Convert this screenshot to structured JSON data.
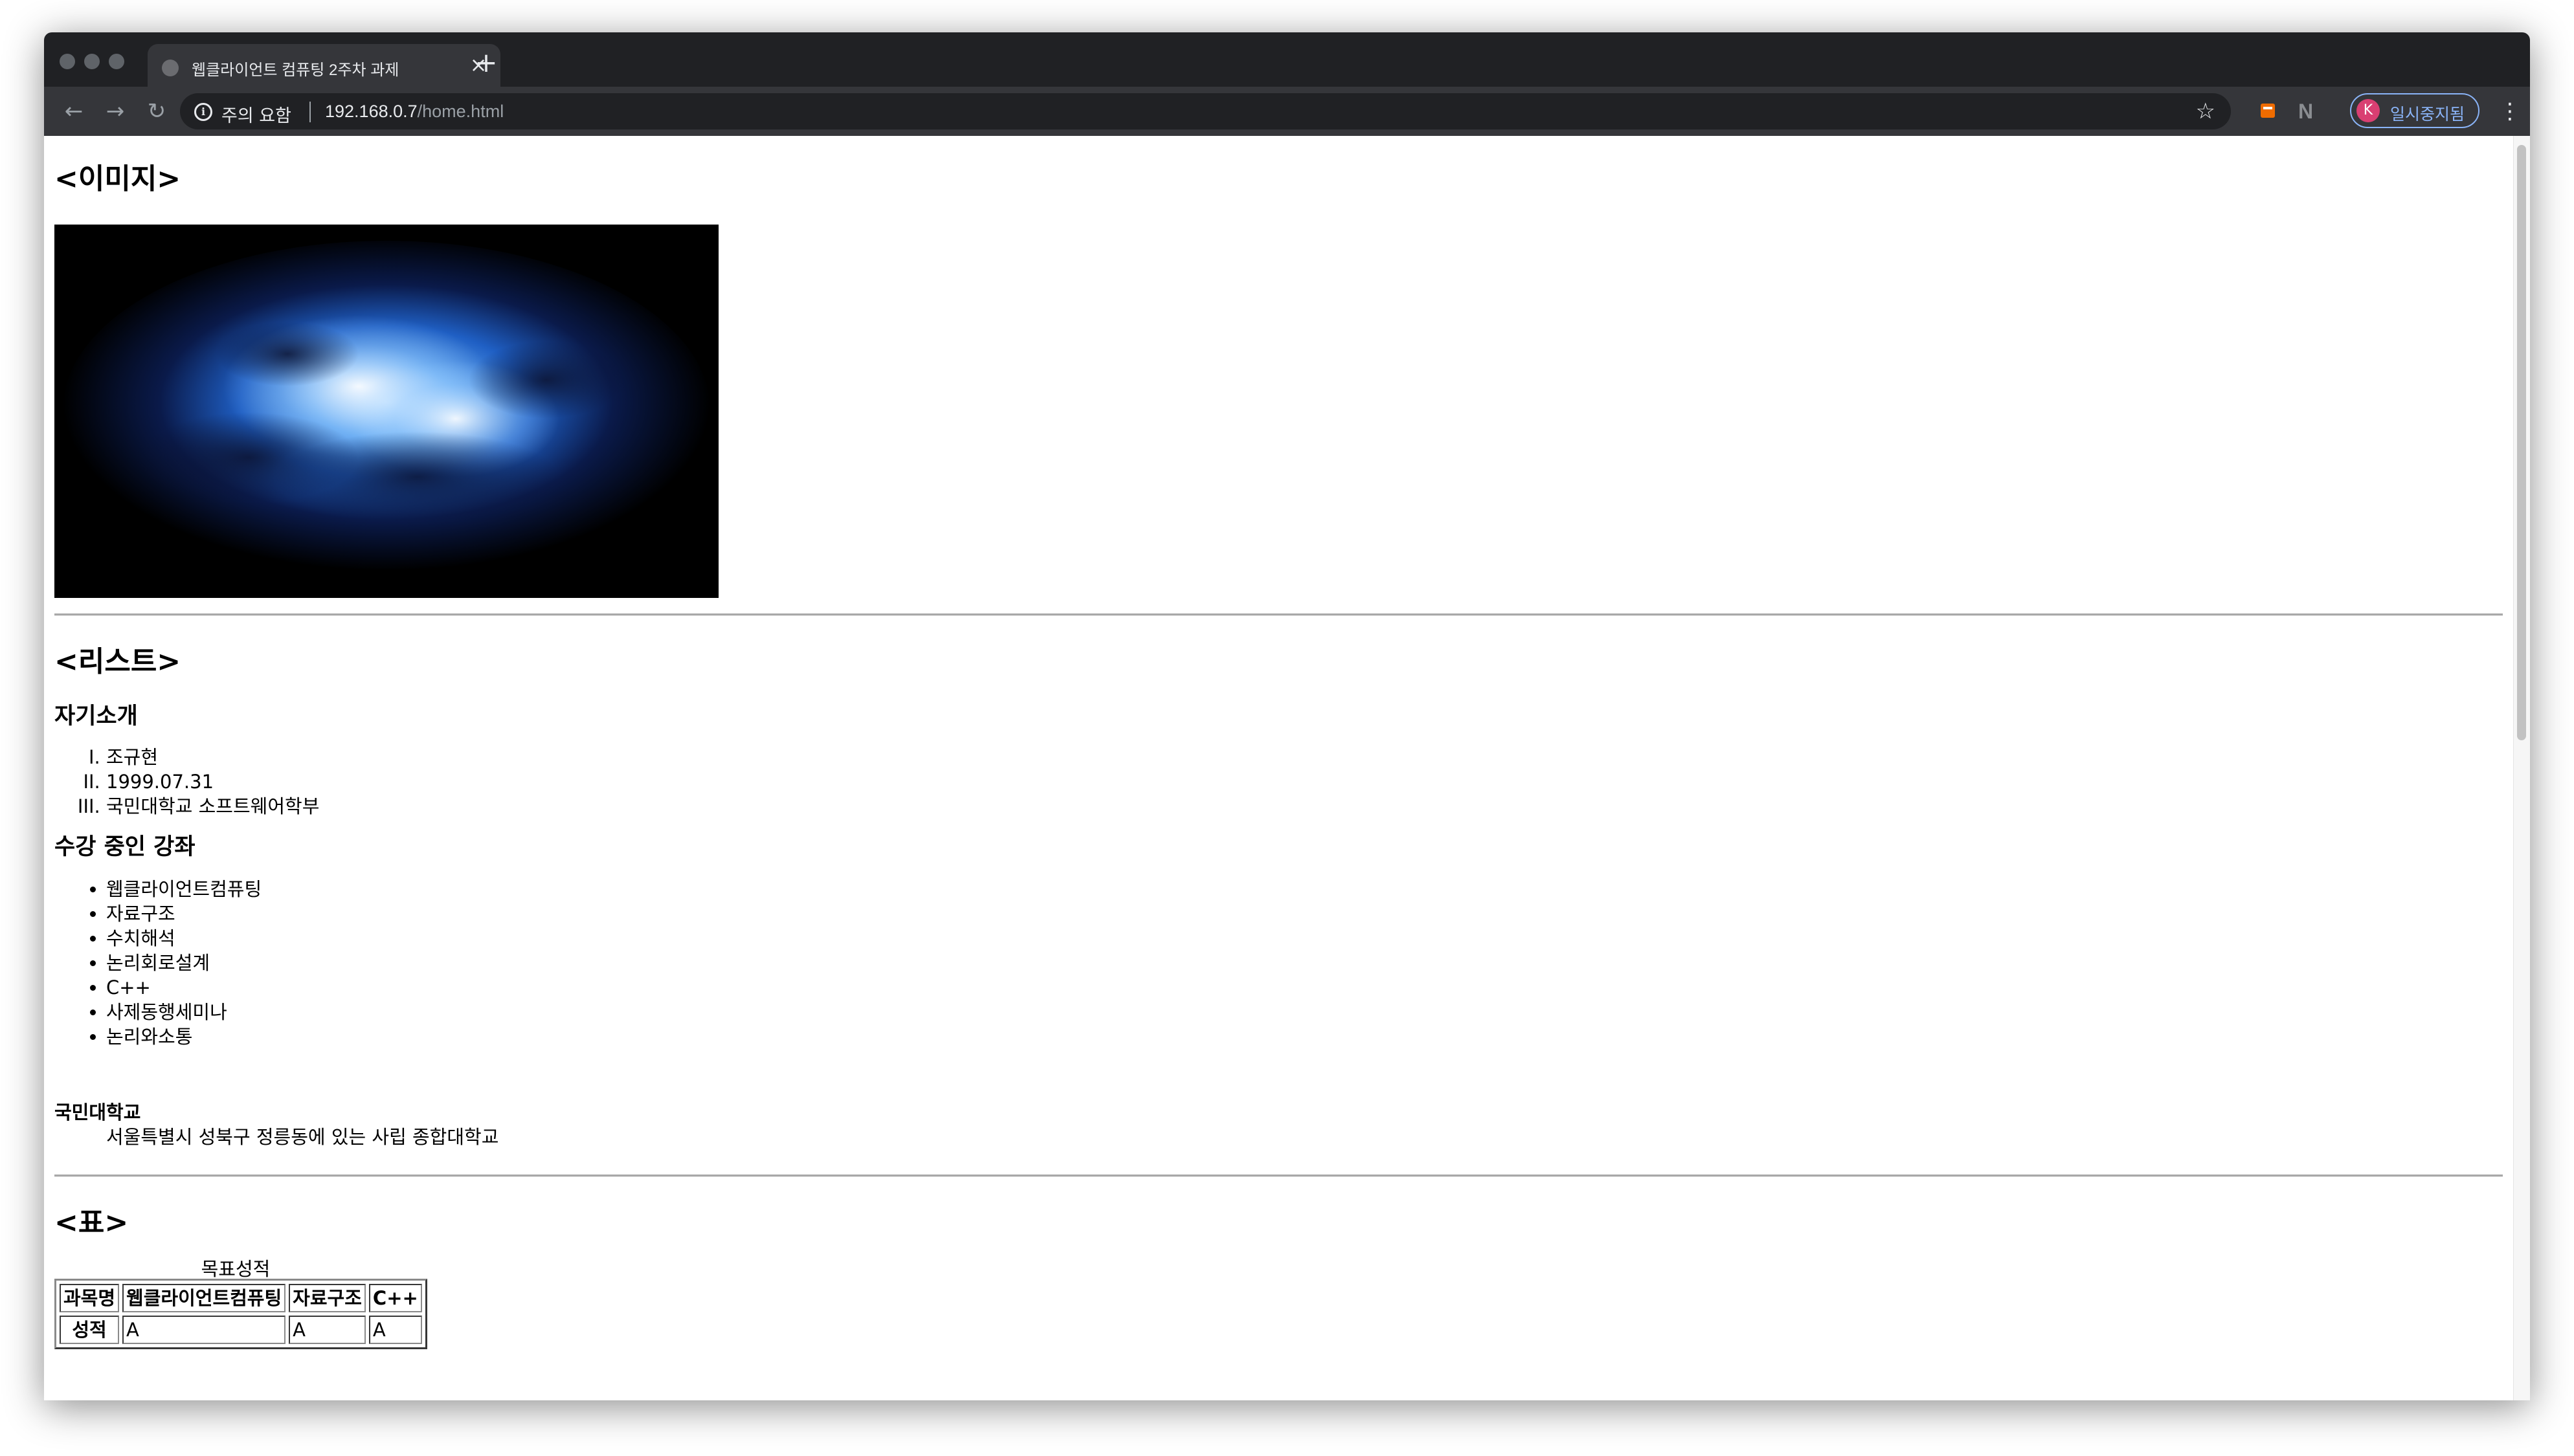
{
  "browser": {
    "tab_title": "웹클라이언트 컴퓨팅 2주차 과제",
    "security_label": "주의 요함",
    "url_host": "192.168.0.7",
    "url_path": "/home.html",
    "profile_initial": "K",
    "profile_label": "일시중지됨",
    "icons": {
      "back": "back-arrow-icon",
      "forward": "forward-arrow-icon",
      "reload": "reload-icon",
      "info": "info-icon",
      "star": "star-icon",
      "close": "close-icon",
      "new_tab": "plus-icon",
      "menu": "more-vert-icon"
    },
    "colors": {
      "chrome_dark": "#202124",
      "chrome_mid": "#35363a",
      "accent": "#8ab4f8",
      "avatar": "#d93f72"
    }
  },
  "page": {
    "image_section": {
      "heading": "<이미지>"
    },
    "list_section": {
      "heading": "<리스트>",
      "intro": {
        "heading": "자기소개",
        "items": [
          "조규현",
          "1999.07.31",
          "국민대학교 소프트웨어학부"
        ]
      },
      "courses": {
        "heading": "수강 중인 강좌",
        "items": [
          "웹클라이언트컴퓨팅",
          "자료구조",
          "수치해석",
          "논리회로설계",
          "C++",
          "사제동행세미나",
          "논리와소통"
        ]
      },
      "definition": {
        "term": "국민대학교",
        "description": "서울특별시 성북구 정릉동에 있는 사립 종합대학교"
      }
    },
    "table_section": {
      "heading": "<표>",
      "caption": "목표성적",
      "headers": [
        "과목명",
        "웹클라이언트컴퓨팅",
        "자료구조",
        "C++"
      ],
      "row": {
        "label": "성적",
        "values": [
          "A",
          "A",
          "A"
        ]
      }
    }
  }
}
